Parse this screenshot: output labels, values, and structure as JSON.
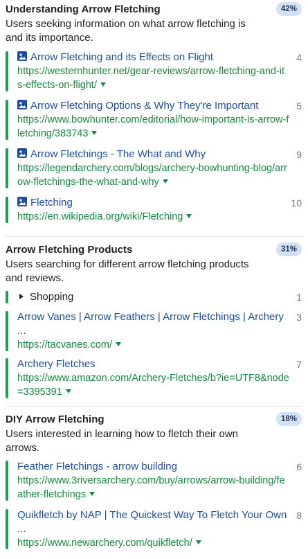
{
  "groups": [
    {
      "title": "Understanding Arrow Fletching",
      "percent": "42%",
      "description": "Users seeking information on what arrow fletching is and its importance.",
      "results": [
        {
          "title": "Arrow Fletching and its Effects on Flight",
          "url": "https://westernhunter.net/gear-reviews/arrow-fletching-and-its-effects-on-flight/",
          "rank": "4",
          "icon": "image-icon"
        },
        {
          "title": "Arrow Fletching Options & Why They're Important",
          "url": "https://www.bowhunter.com/editorial/how-important-is-arrow-fletching/383743",
          "rank": "5",
          "icon": "image-icon"
        },
        {
          "title": "Arrow Fletchings - The What and Why",
          "url": "https://legendarchery.com/blogs/archery-bowhunting-blog/arrow-fletchings-the-what-and-why",
          "rank": "9",
          "icon": "image-icon"
        },
        {
          "title": "Fletching",
          "url": "https://en.wikipedia.org/wiki/Fletching",
          "rank": "10",
          "icon": "image-icon"
        }
      ]
    },
    {
      "title": "Arrow Fletching Products",
      "percent": "31%",
      "description": "Users searching for different arrow fletching products and reviews.",
      "shopping": {
        "label": "Shopping",
        "rank": "1"
      },
      "results": [
        {
          "title": "Arrow Vanes | Arrow Feathers | Arrow Fletchings | Archery ...",
          "url": "https://tacvanes.com/",
          "rank": "3"
        },
        {
          "title": "Archery Fletches",
          "url": "https://www.amazon.com/Archery-Fletches/b?ie=UTF8&node=3395391",
          "rank": "7"
        }
      ]
    },
    {
      "title": "DIY Arrow Fletching",
      "percent": "18%",
      "description": "Users interested in learning how to fletch their own arrows.",
      "results": [
        {
          "title": "Feather Fletchings - arrow building",
          "url": "https://www.3riversarchery.com/buy/arrows/arrow-building/feather-fletchings",
          "rank": "6"
        },
        {
          "title": "Quikfletch by NAP | The Quickest Way To Fletch Your Own ...",
          "url": "https://www.newarchery.com/quikfletch/",
          "rank": "8"
        }
      ]
    }
  ],
  "colors": {
    "accent_bar": "#1e9e50",
    "title_link": "#1a4fa3",
    "url": "#158a3d",
    "badge_bg": "#cfe2f7"
  }
}
